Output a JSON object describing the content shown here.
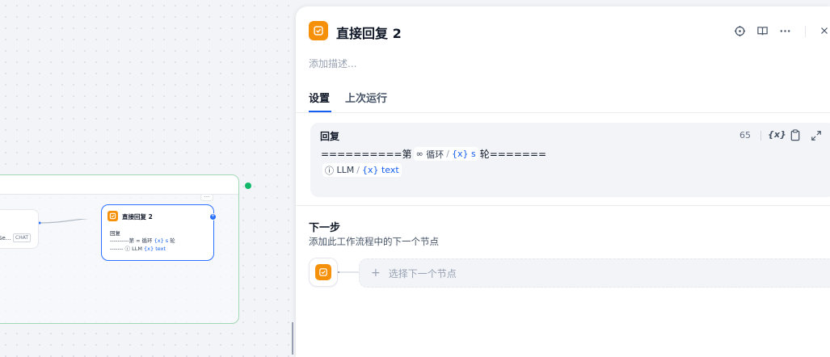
{
  "canvas": {
    "left_node": {
      "text": "Se...",
      "badge": "CHAT"
    },
    "loop_more": "···",
    "mini_node": {
      "title": "直接回复 2",
      "label": "回复",
      "line1_prefix": "----------第",
      "line1_loop": "∞ 循环",
      "line1_var": "{x} s",
      "line1_suffix": "轮",
      "line2_prefix": "-------",
      "line2_llm": "LLM",
      "line2_var": "{x} text"
    }
  },
  "panel": {
    "title": "直接回复 2",
    "description_placeholder": "添加描述...",
    "tabs": [
      {
        "label": "设置",
        "active": true
      },
      {
        "label": "上次运行",
        "active": false
      }
    ],
    "reply": {
      "label": "回复",
      "char_count": "65",
      "var_button": "{x}",
      "line1_prefix": "==========第",
      "line1_loop_node": "循环",
      "line1_var": "{x} s",
      "line1_suffix": "轮=======",
      "line2_node": "LLM",
      "line2_var": "{x} text"
    },
    "next_step": {
      "title": "下一步",
      "subtitle": "添加此工作流程中的下一个节点",
      "select_placeholder": "选择下一个节点",
      "plus": "+"
    }
  },
  "colors": {
    "accent": "#155eef",
    "node_orange": "#f79009",
    "loop_border": "#9fd8b4",
    "success": "#12b76a"
  },
  "icons": [
    "answer-icon",
    "locate-icon",
    "book-icon",
    "more-icon",
    "close-icon",
    "variable-icon",
    "clipboard-icon",
    "expand-icon",
    "loop-icon",
    "llm-icon",
    "plus-icon"
  ]
}
